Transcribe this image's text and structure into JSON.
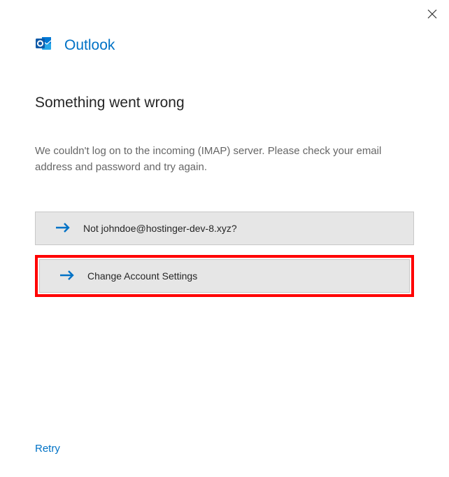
{
  "brand": {
    "name": "Outlook"
  },
  "error": {
    "heading": "Something went wrong",
    "message": "We couldn't log on to the incoming (IMAP) server. Please check your email address and password and try again."
  },
  "options": {
    "not_email_label": "Not johndoe@hostinger-dev-8.xyz?",
    "change_settings_label": "Change Account Settings"
  },
  "actions": {
    "retry_label": "Retry"
  },
  "colors": {
    "accent": "#0072c6",
    "highlight_border": "#ff0000"
  }
}
